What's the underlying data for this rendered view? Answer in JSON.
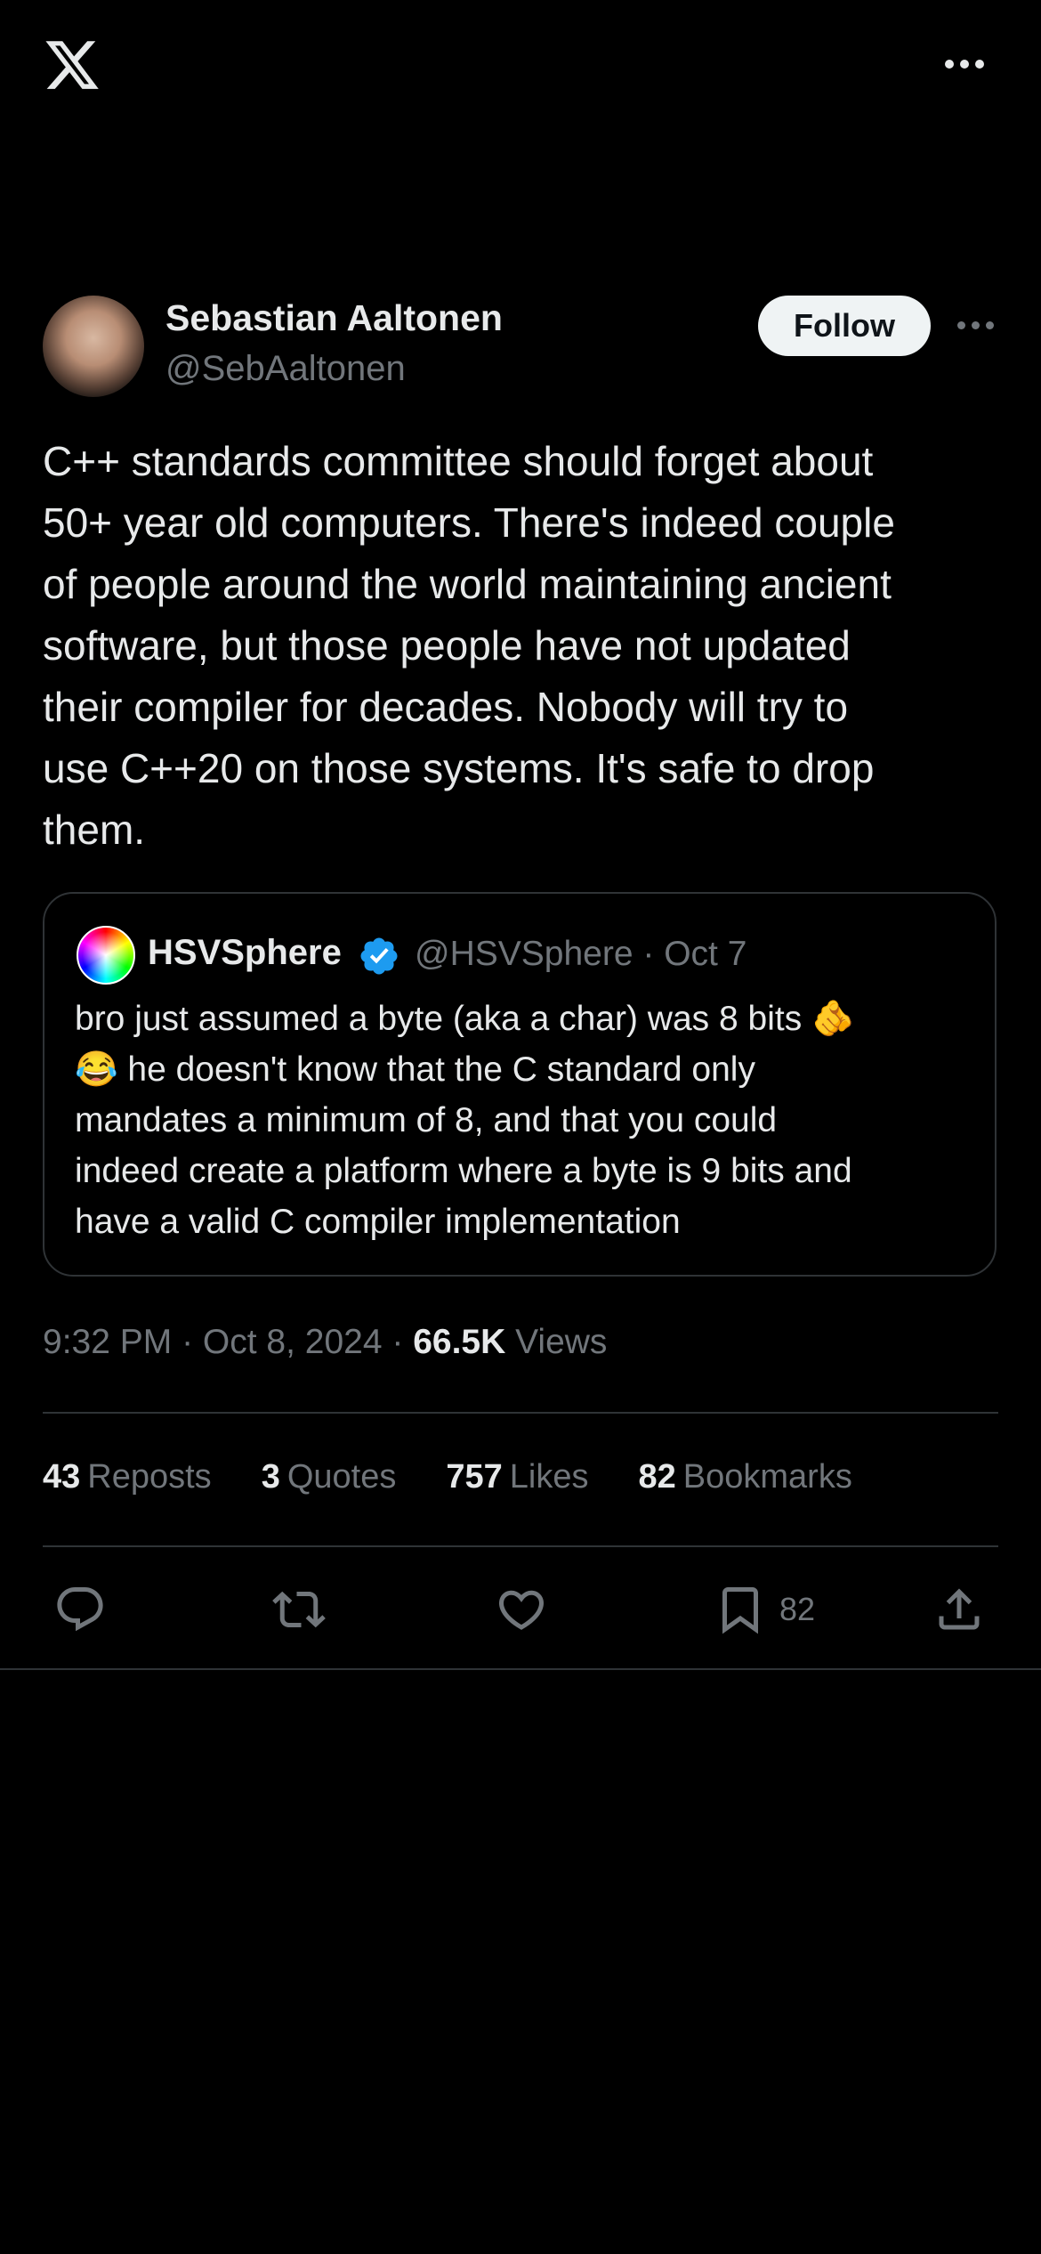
{
  "header": {
    "logo_icon": "x-logo-icon",
    "more_icon": "more-horizontal-icon"
  },
  "author": {
    "name": "Sebastian Aaltonen",
    "handle": "@SebAaltonen",
    "follow_label": "Follow"
  },
  "tweet": {
    "text": "C++ standards committee should forget about\n50+ year old computers. There's indeed couple\nof people around the world maintaining ancient\nsoftware, but those people have not updated\ntheir compiler for decades. Nobody will try to\nuse C++20 on those systems. It's safe to drop\nthem."
  },
  "quote": {
    "name": "HSVSphere",
    "handle_date": "@HSVSphere · Oct 7",
    "verified_icon": "verified-badge-icon",
    "text": "bro just assumed a byte (aka a char) was 8 bits 🫵\n😂 he doesn't know that the C standard only\nmandates a minimum of 8, and that you could\nindeed create a platform where a byte is 9 bits and\nhave a valid C compiler implementation"
  },
  "meta": {
    "time_date": "9:32 PM · Oct 8, 2024 · ",
    "views_count": "66.5K",
    "views_label": " Views"
  },
  "stats": {
    "reposts_count": "43",
    "reposts_label": "Reposts",
    "quotes_count": "3",
    "quotes_label": "Quotes",
    "likes_count": "757",
    "likes_label": "Likes",
    "bookmarks_count": "82",
    "bookmarks_label": "Bookmarks"
  },
  "actions": {
    "bookmark_count": "82"
  },
  "colors": {
    "background": "#000000",
    "text": "#e7e9ea",
    "secondary": "#71767b",
    "border": "#2f3336",
    "verified": "#1d9bf0"
  }
}
